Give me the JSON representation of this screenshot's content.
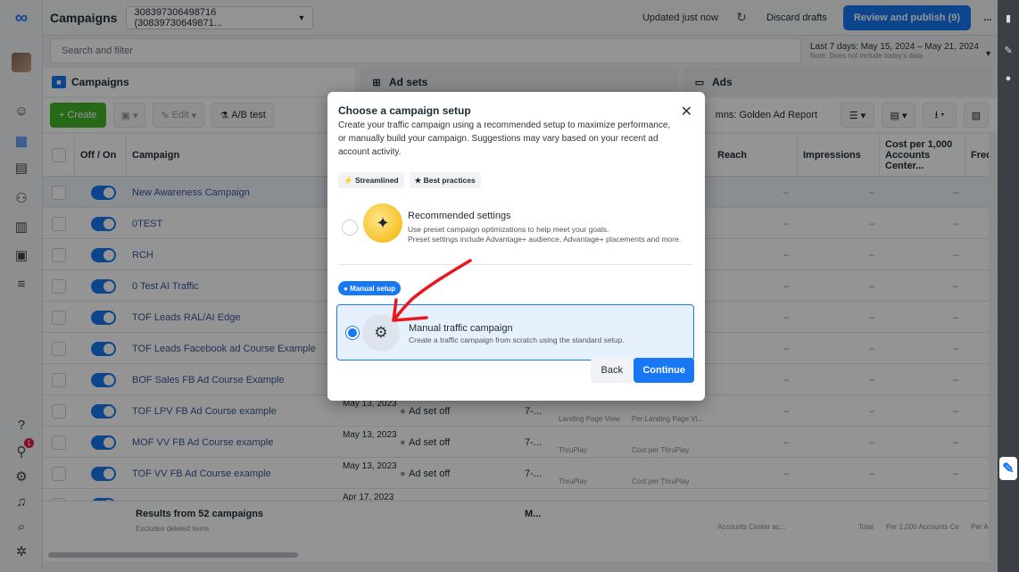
{
  "topbar": {
    "title": "Campaigns",
    "account": "308397306498716 (30839730649871...",
    "updated": "Updated just now",
    "discard": "Discard drafts",
    "review": "Review and publish (9)",
    "more": "..."
  },
  "search": {
    "placeholder": "Search and filter",
    "date_range": "Last 7 days: May 15, 2024 – May 21, 2024",
    "date_note": "Note: Does not include today's data"
  },
  "tabs": [
    "Campaigns",
    "Ad sets",
    "Ads"
  ],
  "toolbar": {
    "create": "+ Create",
    "edit": "Edit",
    "abtest": "A/B test",
    "columns": "mns: Golden Ad Report"
  },
  "table": {
    "headers": {
      "onoff": "Off / On",
      "campaign": "Campaign",
      "reach": "Reach",
      "impressions": "Impressions",
      "cpm": "Cost per 1,000 Accounts Center...",
      "freq": "Frequ"
    },
    "rows": [
      {
        "name": "New Awareness Campaign"
      },
      {
        "name": "0TEST"
      },
      {
        "name": "RCH"
      },
      {
        "name": "0 Test AI Traffic"
      },
      {
        "name": "TOF Leads RAL/AI Edge"
      },
      {
        "name": "TOF Leads Facebook ad Course Example"
      },
      {
        "name": "BOF Sales FB Ad Course Example"
      },
      {
        "name": "TOF LPV FB Ad Course example",
        "date": "May 13, 2023",
        "status": "Ad set off",
        "bid": "7-...",
        "result": "Landing Page View",
        "cost": "Per Landing Page Vi..."
      },
      {
        "name": "MOF VV FB Ad Course example",
        "date": "May 13, 2023",
        "status": "Ad set off",
        "bid": "7-...",
        "result": "ThruPlay",
        "cost": "Cost per ThruPlay"
      },
      {
        "name": "TOF VV FB Ad Course example",
        "date": "May 13, 2023",
        "status": "Ad set off",
        "bid": "7-...",
        "result": "ThruPlay",
        "cost": "Cost per ThruPlay"
      },
      {
        "name": "",
        "date": "Apr 17, 2023",
        "status": "Ad sets off",
        "bid": "7-..."
      }
    ],
    "footer": {
      "results": "Results from 52 campaigns",
      "excludes": "Excludes deleted items",
      "m": "M...",
      "reach_sub": "Accounts Center ac...",
      "total": "Total",
      "cpm_sub": "Per 1,000 Accounts Ce",
      "freq_sub": "Per A"
    }
  },
  "modal": {
    "title": "Choose a campaign setup",
    "description": "Create your traffic campaign using a recommended setup to maximize performance, or manually build your campaign. Suggestions may vary based on your recent ad account activity.",
    "pills": [
      "Streamlined",
      "Best practices"
    ],
    "option1": {
      "title": "Recommended settings",
      "line1": "Use preset campaign optimizations to help meet your goals.",
      "line2": "Preset settings include Advantage+ audience, Advantage+ placements and more."
    },
    "tag": "Manual setup",
    "option2": {
      "title": "Manual traffic campaign",
      "desc": "Create a traffic campaign from scratch using the standard setup."
    },
    "back": "Back",
    "continue": "Continue"
  },
  "accent": "#1877f2",
  "annotation_color": "#e8171d",
  "notification_count": "1"
}
